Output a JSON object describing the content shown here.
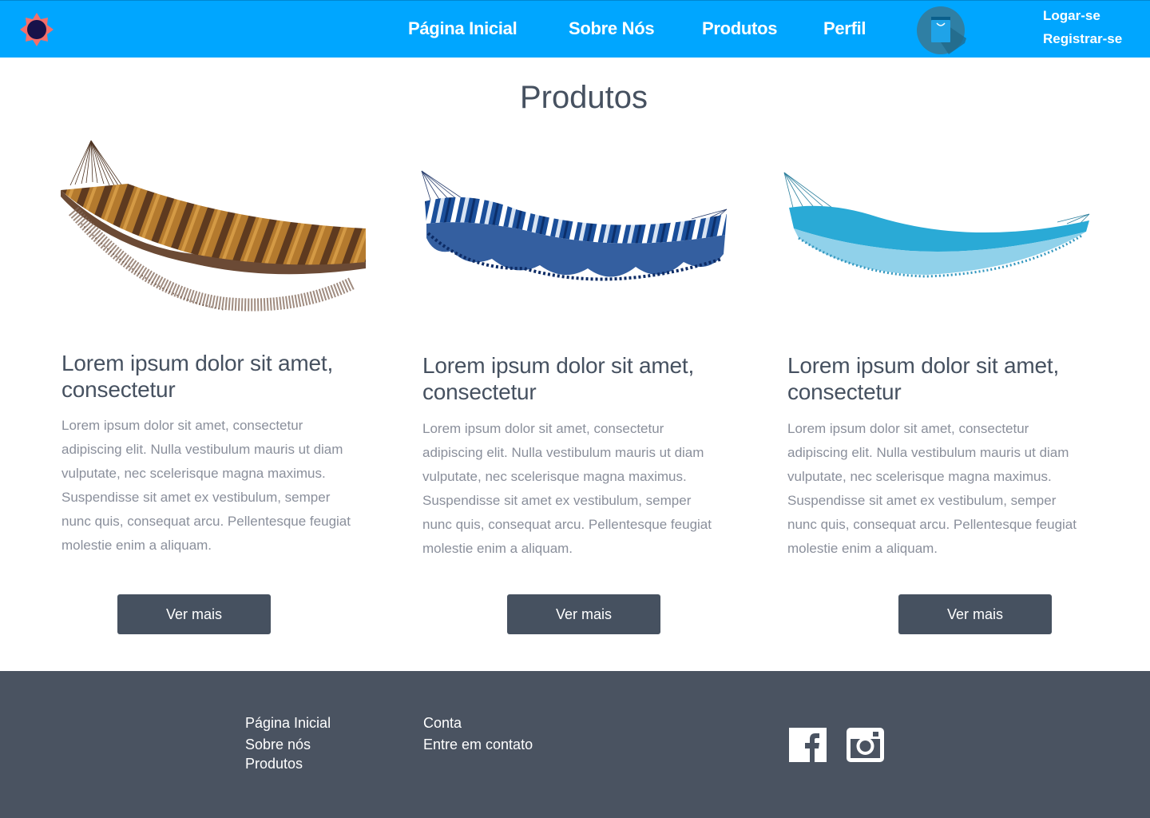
{
  "nav": {
    "links": [
      "Página Inicial",
      "Sobre Nós",
      "Produtos",
      "Perfil"
    ],
    "login": "Logar-se",
    "register": "Registrar-se"
  },
  "page": {
    "title": "Produtos"
  },
  "products": [
    {
      "image": "brown-hammock",
      "heading": "Lorem ipsum dolor sit amet, consectetur",
      "desc_lines": [
        "Lorem ipsum dolor sit amet, consectetur",
        "adipiscing elit. Nulla vestibulum mauris ut diam",
        "vulputate, nec scelerisque magna maximus.",
        "Suspendisse sit amet ex vestibulum, semper",
        "nunc quis, consequat arcu. Pellentesque feugiat",
        "molestie enim a aliquam."
      ],
      "button": "Ver mais"
    },
    {
      "image": "blue-striped-hammock",
      "heading": "Lorem ipsum dolor sit amet, consectetur",
      "desc_lines": [
        "Lorem ipsum dolor sit amet, consectetur",
        "adipiscing elit. Nulla vestibulum mauris ut diam",
        "vulputate, nec scelerisque magna maximus.",
        "Suspendisse sit amet ex vestibulum, semper",
        "nunc quis, consequat arcu. Pellentesque feugiat",
        "molestie enim a aliquam."
      ],
      "button": "Ver mais"
    },
    {
      "image": "turquoise-hammock",
      "heading": "Lorem ipsum dolor sit amet, consectetur",
      "desc_lines": [
        "Lorem ipsum dolor sit amet, consectetur",
        "adipiscing elit. Nulla vestibulum mauris ut diam",
        "vulputate, nec scelerisque magna maximus.",
        "Suspendisse sit amet ex vestibulum, semper",
        "nunc quis, consequat arcu. Pellentesque feugiat",
        "molestie enim a aliquam."
      ],
      "button": "Ver mais"
    }
  ],
  "footer": {
    "col1": [
      "Página Inicial",
      "Sobre nós",
      "Produtos"
    ],
    "col2": [
      "Conta",
      "Entre em contato"
    ],
    "social": [
      "facebook-icon",
      "instagram-icon"
    ]
  },
  "colors": {
    "header": "#00a6ff",
    "text": "#465160",
    "muted": "#8a8f9b",
    "button": "#465160",
    "footer": "#4a5361"
  }
}
